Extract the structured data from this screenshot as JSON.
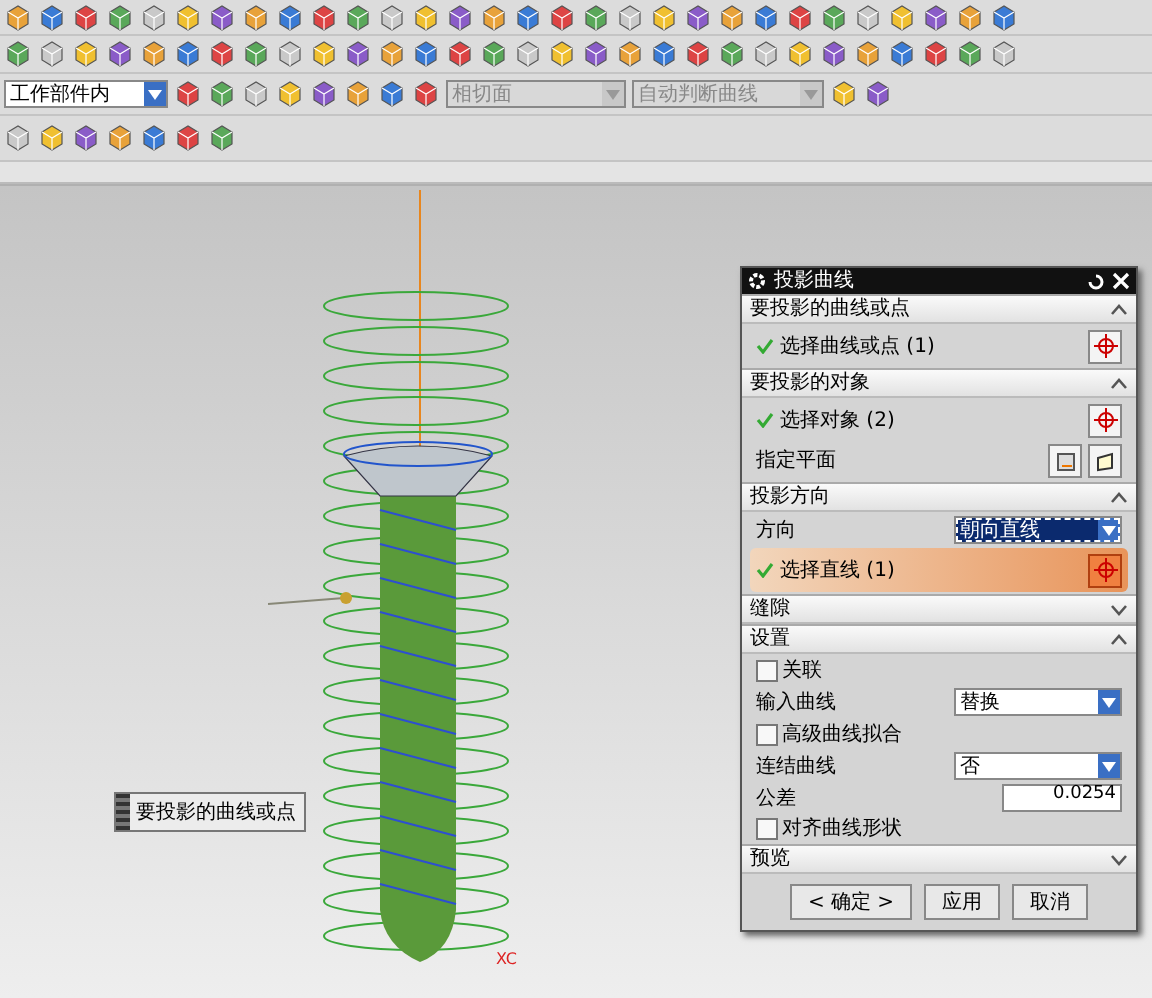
{
  "toolbar": {
    "filter_value": "工作部件内",
    "combo_1": {
      "value": "相切面",
      "disabled": true
    },
    "combo_2": {
      "value": "自动判断曲线",
      "disabled": true
    }
  },
  "canvas": {
    "callout": "要投影的曲线或点",
    "axis_label": "XC"
  },
  "dialog": {
    "title": "投影曲线",
    "sections": [
      {
        "title": "要投影的曲线或点",
        "expanded": true,
        "rows": [
          {
            "kind": "selection",
            "label": "选择曲线或点 (1)",
            "done": true,
            "active": false
          }
        ]
      },
      {
        "title": "要投影的对象",
        "expanded": true,
        "rows": [
          {
            "kind": "selection",
            "label": "选择对象 (2)",
            "done": true,
            "active": false
          },
          {
            "kind": "plane",
            "label": "指定平面"
          }
        ]
      },
      {
        "title": "投影方向",
        "expanded": true,
        "rows": [
          {
            "kind": "dropdown",
            "label": "方向",
            "value": "朝向直线",
            "focused": true
          },
          {
            "kind": "selection",
            "label": "选择直线 (1)",
            "done": true,
            "active": true
          }
        ]
      },
      {
        "title": "缝隙",
        "expanded": false
      },
      {
        "title": "设置",
        "expanded": true,
        "rows": [
          {
            "kind": "checkbox",
            "label": "关联",
            "checked": false
          },
          {
            "kind": "dropdown",
            "label": "输入曲线",
            "value": "替换",
            "focused": false
          },
          {
            "kind": "checkbox",
            "label": "高级曲线拟合",
            "checked": false
          },
          {
            "kind": "dropdown",
            "label": "连结曲线",
            "value": "否",
            "focused": false
          },
          {
            "kind": "number",
            "label": "公差",
            "value": "0.0254"
          },
          {
            "kind": "checkbox",
            "label": "对齐曲线形状",
            "checked": false
          }
        ]
      },
      {
        "title": "预览",
        "expanded": false
      }
    ],
    "buttons": [
      "< 确定 >",
      "应用",
      "取消"
    ]
  }
}
